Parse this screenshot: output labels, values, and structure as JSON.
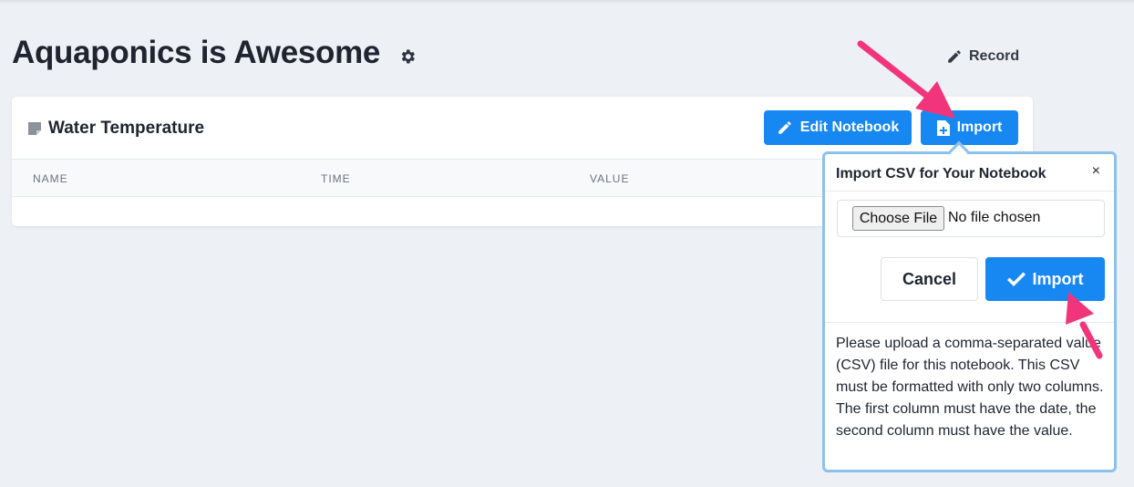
{
  "page": {
    "title": "Aquaponics is Awesome",
    "settings_icon": "gear-icon",
    "record_label": "Record",
    "record_icon": "pencil-icon"
  },
  "notebook": {
    "title": "Water Temperature",
    "icon": "sticky-note-icon",
    "edit_label": "Edit Notebook",
    "import_label": "Import",
    "columns": [
      "NAME",
      "TIME",
      "VALUE"
    ]
  },
  "import_popover": {
    "title": "Import CSV for Your Notebook",
    "close": "×",
    "choose_file_label": "Choose File",
    "file_status": "No file chosen",
    "cancel_label": "Cancel",
    "import_label": "Import",
    "help_text": "Please upload a comma-separated value (CSV) file for this notebook. This CSV must be formatted with only two columns. The first column must have the date, the second column must have the value."
  },
  "colors": {
    "primary": "#1787f2",
    "background": "#edf0f5",
    "popover_border": "#8ec0ee",
    "annotation_arrow": "#f2357a"
  }
}
